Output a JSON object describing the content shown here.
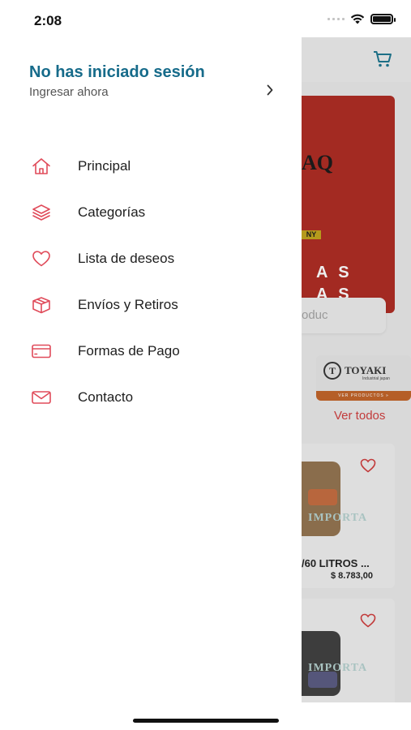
{
  "status_bar": {
    "time": "2:08",
    "icons": [
      "signal-icon",
      "wifi-icon",
      "battery-icon"
    ]
  },
  "drawer": {
    "login_title": "No has iniciado sesión",
    "login_subtitle": "Ingresar ahora",
    "menu": [
      {
        "label": "Principal",
        "icon": "home-icon"
      },
      {
        "label": "Categorías",
        "icon": "layers-icon"
      },
      {
        "label": "Lista de deseos",
        "icon": "heart-icon"
      },
      {
        "label": "Envíos y Retiros",
        "icon": "box-icon"
      },
      {
        "label": "Formas de Pago",
        "icon": "credit-card-icon"
      },
      {
        "label": "Contacto",
        "icon": "mail-icon"
      }
    ],
    "accent_color": "#e04b5a",
    "title_color": "#166b8a"
  },
  "background_app": {
    "banner": {
      "logo_partial": "AQ",
      "tag_partial": "NY",
      "text_partial_line1": "A S",
      "text_partial_line2": "A S"
    },
    "search_placeholder_partial": "oduc",
    "brand": {
      "logo_letter": "T",
      "name": "TOYAKI",
      "subtitle": "Industrial japan",
      "cta": "VER PRODUCTOS »"
    },
    "see_all": "Ver todos",
    "products": [
      {
        "title_partial": "/60 LITROS ...",
        "price": "$ 8.783,00",
        "watermark": "IMPORTA"
      },
      {
        "watermark": "IMPORTA"
      }
    ]
  }
}
